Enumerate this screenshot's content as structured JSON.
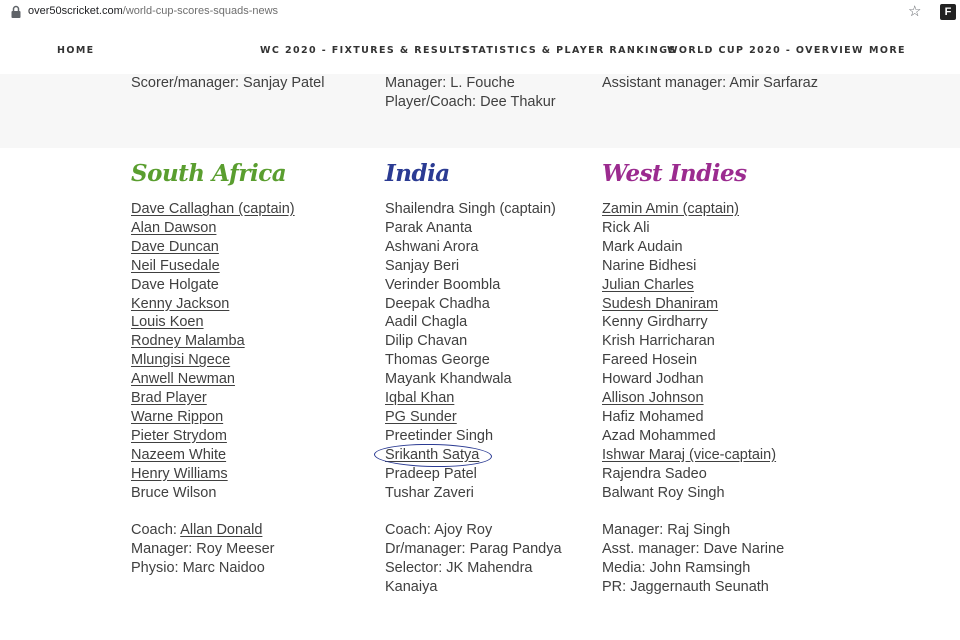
{
  "browser": {
    "url_domain": "over50scricket.com",
    "url_path": "/world-cup-scores-squads-news",
    "bookmark_icon": "star-icon",
    "extension_label": "F"
  },
  "nav": {
    "items": [
      "HOME",
      "WC 2020 - FIXTURES & RESULTS",
      "STATISTICS & PLAYER RANKINGS",
      "WORLD CUP 2020 - OVERVIEW",
      "MORE"
    ]
  },
  "top_band": {
    "col1": [
      "Scorer/manager: Sanjay Patel"
    ],
    "col2": [
      "Manager: L. Fouche",
      "Player/Coach: Dee Thakur"
    ],
    "col3": [
      "Assistant manager: Amir Sarfaraz"
    ]
  },
  "colors": {
    "south_africa": "#5a9e2f",
    "india": "#2b3b93",
    "west_indies": "#9b2b8f",
    "annotation": "#2b3b93"
  },
  "teams": [
    {
      "name": "South Africa",
      "players": [
        {
          "text": "Dave Callaghan (captain)",
          "link": true
        },
        {
          "text": "Alan Dawson",
          "link": true
        },
        {
          "text": "Dave Duncan",
          "link": true
        },
        {
          "text": "Neil Fusedale",
          "link": true
        },
        {
          "text": "Dave Holgate",
          "link": false
        },
        {
          "text": "Kenny Jackson",
          "link": true
        },
        {
          "text": "Louis Koen",
          "link": true
        },
        {
          "text": "Rodney Malamba",
          "link": true
        },
        {
          "text": "Mlungisi Ngece",
          "link": true
        },
        {
          "text": "Anwell Newman",
          "link": true
        },
        {
          "text": "Brad Player",
          "link": true
        },
        {
          "text": "Warne Rippon",
          "link": true
        },
        {
          "text": "Pieter Strydom",
          "link": true
        },
        {
          "text": "Nazeem White",
          "link": true
        },
        {
          "text": "Henry Williams",
          "link": true
        },
        {
          "text": "Bruce Wilson",
          "link": false
        }
      ],
      "staff": [
        {
          "label": "Coach: ",
          "value": "Allan Donald",
          "link": true
        },
        {
          "label": "Manager: ",
          "value": "Roy Meeser",
          "link": false
        },
        {
          "label": "Physio: ",
          "value": "Marc Naidoo",
          "link": false
        }
      ]
    },
    {
      "name": "India",
      "players": [
        {
          "text": "Shailendra Singh (captain)",
          "link": false
        },
        {
          "text": "Parak Ananta",
          "link": false
        },
        {
          "text": "Ashwani Arora",
          "link": false
        },
        {
          "text": "Sanjay Beri",
          "link": false
        },
        {
          "text": "Verinder Boombla",
          "link": false
        },
        {
          "text": "Deepak Chadha",
          "link": false
        },
        {
          "text": "Aadil Chagla",
          "link": false
        },
        {
          "text": "Dilip Chavan",
          "link": false
        },
        {
          "text": "Thomas George",
          "link": false
        },
        {
          "text": "Mayank Khandwala",
          "link": false
        },
        {
          "text": "Iqbal Khan",
          "link": true
        },
        {
          "text": "PG Sunder",
          "link": true
        },
        {
          "text": "Preetinder Singh",
          "link": false
        },
        {
          "text": "Srikanth Satya",
          "link": true
        },
        {
          "text": "Pradeep Patel",
          "link": false
        },
        {
          "text": "Tushar Zaveri",
          "link": false
        }
      ],
      "staff": [
        {
          "label": "Coach: ",
          "value": "Ajoy Roy",
          "link": false
        },
        {
          "label": "Dr/manager: ",
          "value": "Parag Pandya",
          "link": false
        },
        {
          "label": "Selector: ",
          "value": "JK Mahendra",
          "link": false
        },
        {
          "label": "",
          "value": "Kanaiya",
          "link": false
        }
      ]
    },
    {
      "name": "West Indies",
      "players": [
        {
          "text": "Zamin Amin (captain)",
          "link": true
        },
        {
          "text": "Rick Ali",
          "link": false
        },
        {
          "text": "Mark Audain",
          "link": false
        },
        {
          "text": "Narine Bidhesi",
          "link": false
        },
        {
          "text": "Julian Charles",
          "link": true
        },
        {
          "text": "Sudesh Dhaniram",
          "link": true
        },
        {
          "text": "Kenny Girdharry",
          "link": false
        },
        {
          "text": "Krish Harricharan",
          "link": false
        },
        {
          "text": "Fareed Hosein",
          "link": false
        },
        {
          "text": "Howard Jodhan",
          "link": false
        },
        {
          "text": "Allison Johnson",
          "link": true
        },
        {
          "text": "Hafiz Mohamed",
          "link": false
        },
        {
          "text": "Azad Mohammed",
          "link": false
        },
        {
          "text": "Ishwar Maraj (vice-captain)",
          "link": true
        },
        {
          "text": "Rajendra Sadeo",
          "link": false
        },
        {
          "text": "Balwant Roy Singh",
          "link": false
        }
      ],
      "staff": [
        {
          "label": "Manager: ",
          "value": "Raj Singh",
          "link": false
        },
        {
          "label": "Asst. manager: ",
          "value": "Dave Narine",
          "link": false
        },
        {
          "label": "Media: ",
          "value": "John Ramsingh",
          "link": false
        },
        {
          "label": "PR: ",
          "value": "Jaggernauth Seunath",
          "link": false
        }
      ]
    }
  ]
}
